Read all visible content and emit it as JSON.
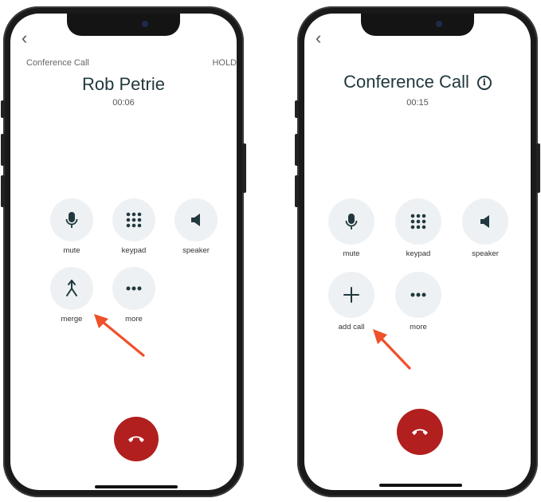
{
  "left_phone": {
    "back_icon": "chevron-left-icon",
    "conference_label": "Conference Call",
    "hold_label": "HOLD",
    "caller_name": "Rob Petrie",
    "timer": "00:06",
    "controls": [
      {
        "label": "mute",
        "icon": "microphone-icon"
      },
      {
        "label": "keypad",
        "icon": "keypad-icon"
      },
      {
        "label": "speaker",
        "icon": "speaker-icon"
      },
      {
        "label": "merge",
        "icon": "merge-icon"
      },
      {
        "label": "more",
        "icon": "more-dots-icon"
      }
    ],
    "end_call_icon": "end-call-icon"
  },
  "right_phone": {
    "back_icon": "chevron-left-icon",
    "title": "Conference Call",
    "info_icon": "info-icon",
    "info_glyph": "i",
    "timer": "00:15",
    "controls": [
      {
        "label": "mute",
        "icon": "microphone-icon"
      },
      {
        "label": "keypad",
        "icon": "keypad-icon"
      },
      {
        "label": "speaker",
        "icon": "speaker-icon"
      },
      {
        "label": "add call",
        "icon": "plus-icon"
      },
      {
        "label": "more",
        "icon": "more-dots-icon"
      }
    ],
    "end_call_icon": "end-call-icon"
  },
  "colors": {
    "accent_dark": "#21393e",
    "button_bg": "#eef1f3",
    "end_call": "#b21f1f",
    "annotation_arrow": "#f0502a"
  }
}
